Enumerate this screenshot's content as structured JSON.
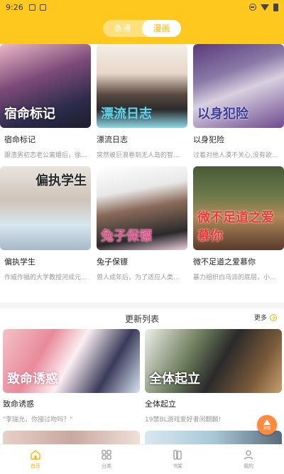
{
  "status_bar": {
    "time": "9:26"
  },
  "top_tabs": [
    {
      "label": "条漫",
      "active": false
    },
    {
      "label": "漫画",
      "active": true
    }
  ],
  "featured": [
    {
      "title": "宿命标记",
      "desc": "跟渣男初恋老公离婚后，徐...",
      "cover_text": "宿命标记"
    },
    {
      "title": "漂流日志",
      "desc": "突然被巨浪卷到无人岛的智...",
      "cover_text": "漂流日志"
    },
    {
      "title": "以身犯险",
      "desc": "过着对他人漠不关心,没有欲...",
      "cover_text": "以身犯险"
    },
    {
      "title": "偏执学生",
      "desc": "作威作福的大学教授河成元...",
      "cover_text": "偏执学生"
    },
    {
      "title": "兔子保镖",
      "desc": "兽人成年后，为了适应人类...",
      "cover_text": "兔子保镖"
    },
    {
      "title": "微不足道之爱慕你",
      "desc": "暴力组织白乌派的底层，小...",
      "cover_text": "微不足道之爱慕你"
    }
  ],
  "updates": {
    "title": "更新列表",
    "more_label": "更多",
    "items": [
      {
        "title": "致命诱惑",
        "desc": "\"李瑞允，你接过吻吗？\"",
        "cover_text": "致命诱惑"
      },
      {
        "title": "全体起立",
        "desc": "19禁BL游戏爱好者闵麒麟!",
        "cover_text": "全体起立"
      }
    ]
  },
  "floating_button": {
    "label": "报错",
    "icon": "warning-icon"
  },
  "bottom_tabs": [
    {
      "label": "首页",
      "icon": "home-icon",
      "active": true
    },
    {
      "label": "分类",
      "icon": "category-icon",
      "active": false
    },
    {
      "label": "书架",
      "icon": "bookshelf-icon",
      "active": false
    },
    {
      "label": "我的",
      "icon": "profile-icon",
      "active": false
    }
  ],
  "colors": {
    "accent": "#ffc81e",
    "accent_text": "#ffb400",
    "muted": "#999999"
  }
}
